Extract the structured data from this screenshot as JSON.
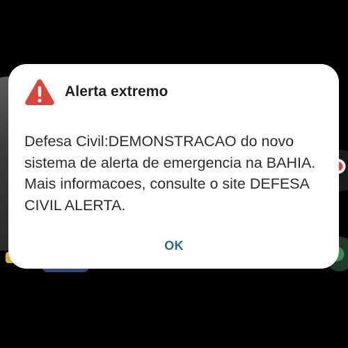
{
  "alert": {
    "title": "Alerta extremo",
    "icon": "warning-triangle-icon",
    "message": "Defesa Civil:DEMONSTRACAO do novo sistema de alerta de emergencia na BAHIA. Mais informacoes, consulte o site DEFESA CIVIL ALERTA.",
    "ok_label": "OK"
  },
  "colors": {
    "background": "#000000",
    "dialog": "#ffffff",
    "warning": "#d9463b",
    "button_text": "#2b6a8f"
  }
}
